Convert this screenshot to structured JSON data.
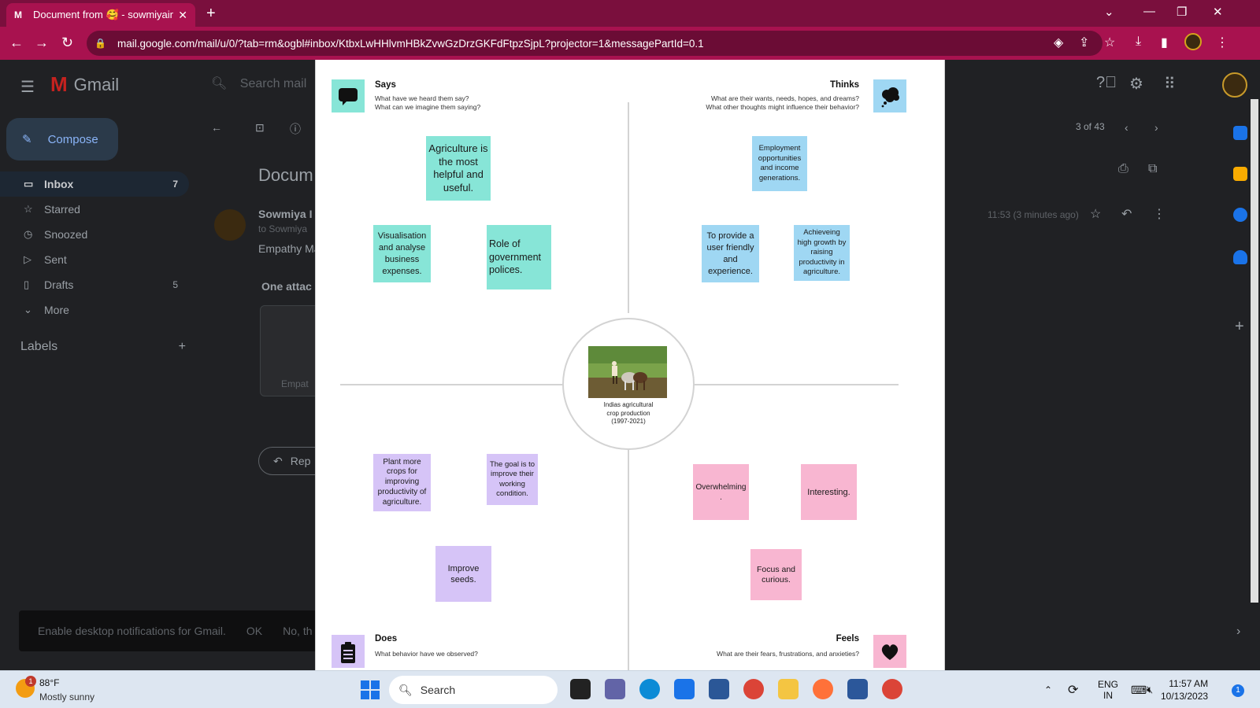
{
  "browser": {
    "tab_title": "Document from 🥰 - sowmiyain",
    "url": "mail.google.com/mail/u/0/?tab=rm&ogbl#inbox/KtbxLwHHlvmHBkZvwGzDrzGKFdFtpzSjpL?projector=1&messagePartId=0.1"
  },
  "gmail": {
    "app_name": "Gmail",
    "search_placeholder": "Search mail",
    "compose_label": "Compose",
    "nav": [
      {
        "label": "Inbox",
        "count": "7"
      },
      {
        "label": "Starred",
        "count": ""
      },
      {
        "label": "Snoozed",
        "count": ""
      },
      {
        "label": "Sent",
        "count": ""
      },
      {
        "label": "Drafts",
        "count": "5"
      },
      {
        "label": "More",
        "count": ""
      }
    ],
    "labels_heading": "Labels",
    "pager": "3 of 43",
    "subject": "Docum",
    "sender_name": "Sowmiya I",
    "sender_to": "to Sowmiya",
    "snippet": "Empathy Ma",
    "attachments_label": "One attac",
    "attachment_name": "Empat",
    "reply_label": "Rep",
    "mail_time": "11:53 (3 minutes ago)",
    "notification": {
      "text": "Enable desktop notifications for Gmail.",
      "ok": "OK",
      "no": "No, th"
    }
  },
  "empathy_map": {
    "says": {
      "title": "Says",
      "sub1": "What have we heard them say?",
      "sub2": "What can we imagine them saying?"
    },
    "thinks": {
      "title": "Thinks",
      "sub1": "What are their wants, needs, hopes, and dreams?",
      "sub2": "What other thoughts might influence their behavior?"
    },
    "does": {
      "title": "Does",
      "sub1": "What behavior have we observed?"
    },
    "feels": {
      "title": "Feels",
      "sub1": "What are their fears, frustrations, and anxieties?"
    },
    "center_caption": "Indias agricultural crop production (1997-2021)",
    "notes": {
      "says1": "Agriculture is the most helpful and useful.",
      "says2": "Visualisation and analyse business expenses.",
      "says3": "Role of government polices.",
      "thinks1": "Employment opportunities and income generations.",
      "thinks2": "To provide a user friendly and experience.",
      "thinks3": "Achieveing high growth by raising productivity in agriculture.",
      "does1": "Plant more crops for improving productivity of agriculture.",
      "does2": "The goal is to improve their working condition.",
      "does3": "Improve seeds.",
      "feels1": "Overwhelming .",
      "feels2": "Interesting.",
      "feels3": "Focus and curious."
    },
    "colors": {
      "says": "#87e5d7",
      "thinks": "#9fd7f3",
      "does": "#d6c4f7",
      "feels": "#f8b6d1"
    }
  },
  "taskbar": {
    "temp": "88°F",
    "weather": "Mostly sunny",
    "weather_badge": "1",
    "search_label": "Search",
    "lang1": "ENG",
    "lang2": "IN",
    "time": "11:57 AM",
    "date": "10/13/2023",
    "notif_count": "1"
  }
}
